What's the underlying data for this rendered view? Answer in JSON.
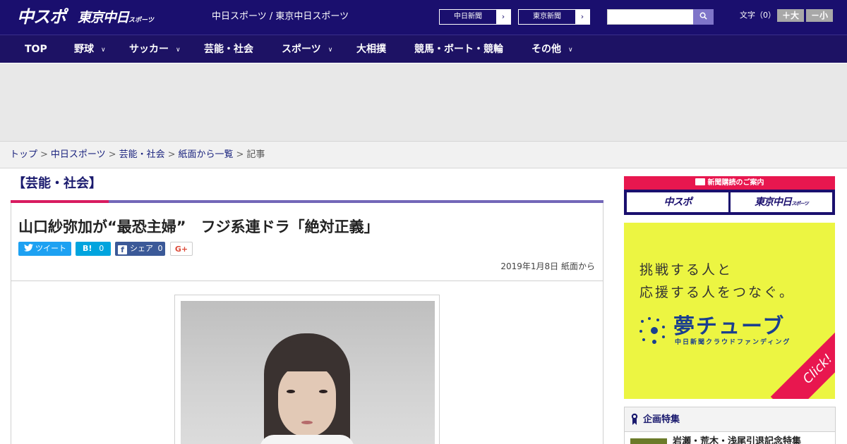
{
  "header": {
    "logo_main": "中スポ",
    "logo_tokyo": "東京中日",
    "logo_tokyo_suffix": "スポーツ",
    "site_name": "中日スポーツ / 東京中日スポーツ",
    "links": [
      {
        "label": "中日新聞"
      },
      {
        "label": "東京新聞"
      }
    ],
    "search_placeholder": "",
    "fontsize_label": "文字（0）",
    "fontsize_up": "＋大",
    "fontsize_down": "－小"
  },
  "nav": {
    "items": [
      {
        "label": "TOP",
        "has_dropdown": false
      },
      {
        "label": "野球",
        "has_dropdown": true
      },
      {
        "label": "サッカー",
        "has_dropdown": true
      },
      {
        "label": "芸能・社会",
        "has_dropdown": false
      },
      {
        "label": "スポーツ",
        "has_dropdown": true
      },
      {
        "label": "大相撲",
        "has_dropdown": false
      },
      {
        "label": "競馬・ボート・競輪",
        "has_dropdown": false
      },
      {
        "label": "その他",
        "has_dropdown": true
      }
    ]
  },
  "breadcrumb": {
    "items": [
      "トップ",
      "中日スポーツ",
      "芸能・社会",
      "紙面から一覧"
    ],
    "current": "記事",
    "separator": ">"
  },
  "article": {
    "section": "【芸能・社会】",
    "headline": "山口紗弥加が“最恐主婦”　フジ系連ドラ「絶対正義」",
    "share": {
      "tweet_label": "ツイート",
      "hatena_label": "B!",
      "hatena_count": "0",
      "facebook_icon": "f",
      "facebook_label": "シェア",
      "facebook_count": "0",
      "gplus_label": "G+"
    },
    "date": "2019年1月8日 紙面から"
  },
  "sidebar": {
    "subscribe_header": "新聞購読のご案内",
    "subscribe_logos": [
      "中スポ",
      "東京中日"
    ],
    "subscribe_logo_suffix": "スポーツ",
    "ad": {
      "line1": "挑戦する人と",
      "line2": "応援する人をつなぐ。",
      "logo": "夢チューブ",
      "logo_sub": "中日新聞クラウドファンディング",
      "click_label": "Click!"
    },
    "kikaku": {
      "header": "企画特集",
      "item": "岩瀬・荒木・浅尾引退記念特集"
    }
  },
  "colors": {
    "header_bg": "#1a0f6e",
    "nav_bg": "#1d1264",
    "accent_red": "#d81b60",
    "accent_purple": "#7367b8",
    "ad_yellow": "#ecf542"
  }
}
